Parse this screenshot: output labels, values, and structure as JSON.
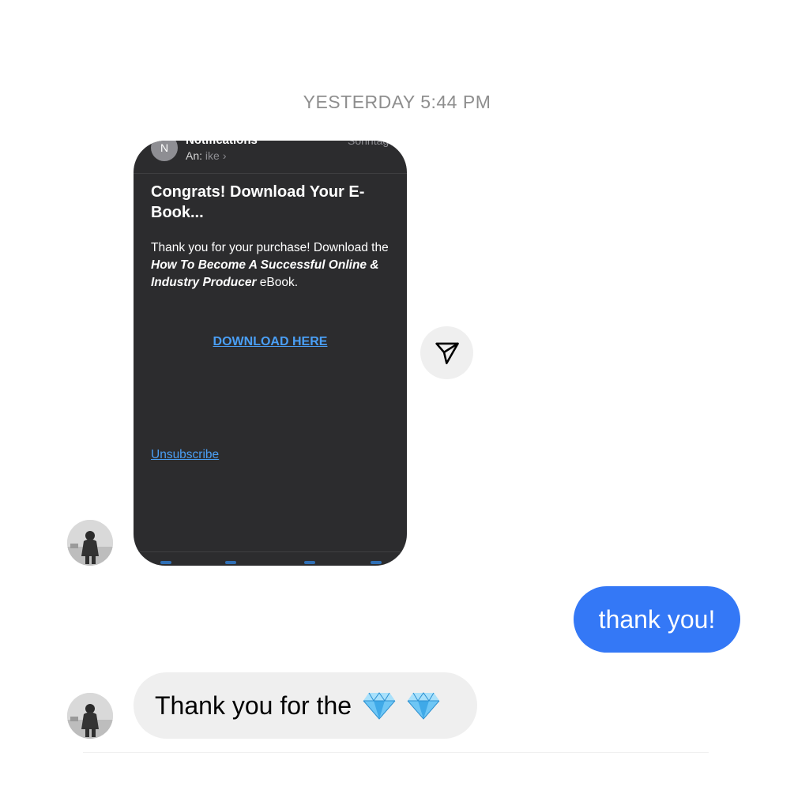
{
  "timestamp": "YESTERDAY 5:44 PM",
  "shared_email": {
    "sender_initial": "N",
    "sender_name": "Notifications",
    "date": "Sonntag",
    "to_label": "An:",
    "recipient": "ike",
    "recipient_chevron": "›",
    "subject": "Congrats! Download Your E-Book...",
    "body_prefix": "Thank you for your purchase! Download the ",
    "body_product": "How To Become A Successful Online & Industry Producer",
    "body_suffix": " eBook.",
    "download_link": "DOWNLOAD HERE",
    "unsubscribe_link": "Unsubscribe"
  },
  "share_button": {
    "icon": "paper-plane-icon"
  },
  "messages": {
    "sent": "thank you!",
    "received": "Thank you for the",
    "received_emojis": [
      "gem-stone-icon",
      "gem-stone-icon"
    ]
  },
  "colors": {
    "sent_bubble": "#3478f6",
    "received_bubble": "#efefef",
    "email_background": "#2c2c2e",
    "link": "#4a9ff5",
    "timestamp": "#8e8e8e"
  }
}
